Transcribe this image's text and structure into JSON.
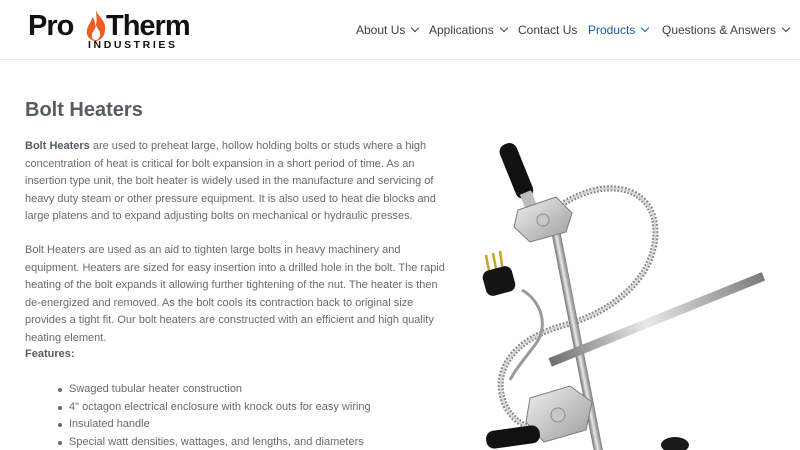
{
  "brand": {
    "name_part1": "Pro",
    "name_part2": "Therm",
    "subtitle": "INDUSTRIES",
    "colors": {
      "flame": "#f05a24",
      "text": "#111111"
    }
  },
  "nav": {
    "items": [
      {
        "label": "About Us",
        "has_dropdown": true,
        "active": false
      },
      {
        "label": "Applications",
        "has_dropdown": true,
        "active": false
      },
      {
        "label": "Contact Us",
        "has_dropdown": false,
        "active": false
      },
      {
        "label": "Products",
        "has_dropdown": true,
        "active": true
      },
      {
        "label": "Questions & Answers",
        "has_dropdown": true,
        "active": false
      }
    ],
    "active_color": "#1d5a9c"
  },
  "page": {
    "title": "Bolt Heaters",
    "intro_bold": "Bolt Heaters",
    "intro_rest": " are used to preheat large, hollow holding bolts or studs where a high concentration of heat is critical for bolt expansion in a short period of time. As an insertion type unit, the bolt heater is widely used in the manufacture and servicing of heavy duty steam or other pressure equipment. It is also used to heat die blocks and large platens and to expand adjusting bolts on mechanical or hydraulic presses.",
    "paragraph2": "Bolt Heaters are used as an aid to tighten large bolts in heavy machinery and equipment. Heaters are sized for easy insertion into a drilled hole in the bolt. The rapid heating of the bolt expands it allowing further tightening of the nut. The heater is then de-energized and removed. As the bolt cools its contraction back to original size provides a tight fit. Our bolt heaters are constructed with an efficient and high quality heating element.",
    "features_heading": "Features:",
    "features": [
      "Swaged tubular heater construction",
      "4\" octagon electrical enclosure with knock outs for easy wiring",
      "Insulated handle",
      "Special watt densities, wattages, and lengths, and diameters"
    ]
  }
}
